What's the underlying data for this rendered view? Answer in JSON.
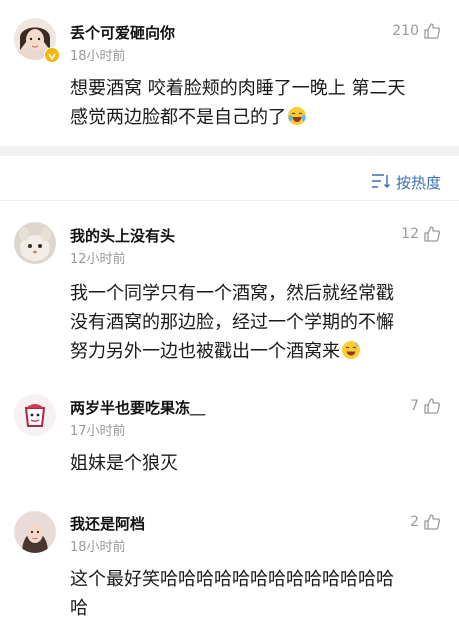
{
  "colors": {
    "accent": "#3a6fb0",
    "meta_gray": "#9a9a9a",
    "text": "#1a1a1a",
    "divider": "#f1f1f1"
  },
  "sort": {
    "icon": "sort-lines-icon",
    "label": "按热度"
  },
  "comments": [
    {
      "username": "丢个可爱砸向你",
      "time": "18小时前",
      "likes": "210",
      "verified": true,
      "lines": [
        "想要酒窝 咬着脸颊的肉睡了一晚上 第二天",
        "感觉两边脸都不是自己的了"
      ],
      "emoji": "crying-laughing-emoji"
    },
    {
      "username": "我的头上没有头",
      "time": "12小时前",
      "likes": "12",
      "lines": [
        "我一个同学只有一个酒窝，然后就经常戳",
        "没有酒窝的那边脸，经过一个学期的不懈",
        "努力另外一边也被戳出一个酒窝来"
      ],
      "emoji": "sweat-smile-emoji"
    },
    {
      "username": "两岁半也要吃果冻＿",
      "time": "17小时前",
      "likes": "7",
      "lines": [
        "姐妹是个狼灭"
      ]
    },
    {
      "username": "我还是阿档",
      "time": "18小时前",
      "likes": "2",
      "lines": [
        "这个最好笑哈哈哈哈哈哈哈哈哈哈哈哈哈",
        "哈"
      ]
    }
  ]
}
